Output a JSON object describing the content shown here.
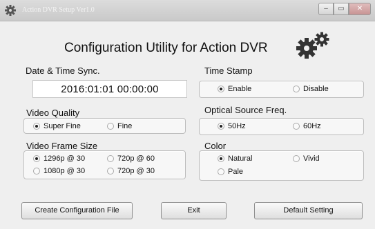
{
  "window": {
    "title": "Action DVR Setup Ver1.0",
    "controls": {
      "minimize": "–",
      "maximize": "▭",
      "close": "✕"
    }
  },
  "heading": "Configuration Utility for Action DVR",
  "datetime": {
    "label": "Date & Time Sync.",
    "value": "2016:01:01  00:00:00"
  },
  "video_quality": {
    "label": "Video Quality",
    "options": [
      "Super Fine",
      "Fine"
    ],
    "selected": "Super Fine"
  },
  "video_frame_size": {
    "label": "Video Frame Size",
    "options": [
      "1296p @ 30",
      "720p @ 60",
      "1080p @ 30",
      "720p @ 30"
    ],
    "selected": "1296p @ 30"
  },
  "time_stamp": {
    "label": "Time Stamp",
    "options": [
      "Enable",
      "Disable"
    ],
    "selected": "Enable"
  },
  "optical_source_freq": {
    "label": "Optical Source Freq.",
    "options": [
      "50Hz",
      "60Hz"
    ],
    "selected": "50Hz"
  },
  "color": {
    "label": "Color",
    "options": [
      "Natural",
      "Vivid",
      "Pale"
    ],
    "selected": "Natural"
  },
  "buttons": {
    "create": "Create Configuration File",
    "exit": "Exit",
    "default": "Default Setting"
  },
  "icons": {
    "app": "gear-icon",
    "heading_decoration": "gears-icon"
  },
  "colors": {
    "titlebar": "#cfcfcf",
    "window_bg": "#efefef",
    "panel_bg": "#f7f7f7"
  }
}
